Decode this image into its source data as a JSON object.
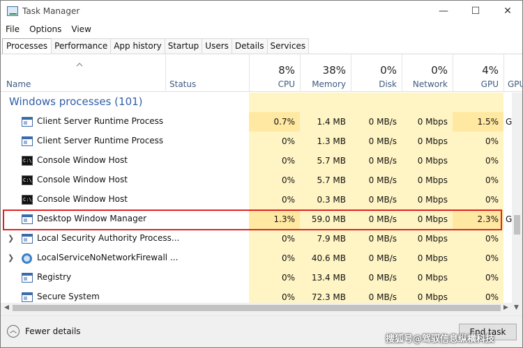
{
  "window": {
    "title": "Task Manager",
    "controls": {
      "minimize": "—",
      "maximize": "☐",
      "close": "✕"
    }
  },
  "menu": [
    "File",
    "Options",
    "View"
  ],
  "tabs": [
    "Processes",
    "Performance",
    "App history",
    "Startup",
    "Users",
    "Details",
    "Services"
  ],
  "active_tab": "Processes",
  "columns": {
    "name": "Name",
    "status": "Status",
    "cpu": {
      "pct": "8%",
      "label": "CPU"
    },
    "memory": {
      "pct": "38%",
      "label": "Memory"
    },
    "disk": {
      "pct": "0%",
      "label": "Disk"
    },
    "network": {
      "pct": "0%",
      "label": "Network"
    },
    "gpu": {
      "pct": "4%",
      "label": "GPU"
    },
    "gpu_engine": "GPU"
  },
  "group": {
    "title": "Windows processes (101)"
  },
  "processes": [
    {
      "name": "Client Server Runtime Process",
      "icon": "window-icon",
      "expandable": false,
      "cpu": "0.7%",
      "memory": "1.4 MB",
      "disk": "0 MB/s",
      "network": "0 Mbps",
      "gpu": "1.5%",
      "gpu_engine": "G"
    },
    {
      "name": "Client Server Runtime Process",
      "icon": "window-icon",
      "expandable": false,
      "cpu": "0%",
      "memory": "1.3 MB",
      "disk": "0 MB/s",
      "network": "0 Mbps",
      "gpu": "0%",
      "gpu_engine": ""
    },
    {
      "name": "Console Window Host",
      "icon": "console-icon",
      "expandable": false,
      "cpu": "0%",
      "memory": "5.7 MB",
      "disk": "0 MB/s",
      "network": "0 Mbps",
      "gpu": "0%",
      "gpu_engine": ""
    },
    {
      "name": "Console Window Host",
      "icon": "console-icon",
      "expandable": false,
      "cpu": "0%",
      "memory": "5.7 MB",
      "disk": "0 MB/s",
      "network": "0 Mbps",
      "gpu": "0%",
      "gpu_engine": ""
    },
    {
      "name": "Console Window Host",
      "icon": "console-icon",
      "expandable": false,
      "cpu": "0%",
      "memory": "0.3 MB",
      "disk": "0 MB/s",
      "network": "0 Mbps",
      "gpu": "0%",
      "gpu_engine": ""
    },
    {
      "name": "Desktop Window Manager",
      "icon": "window-icon",
      "expandable": false,
      "cpu": "1.3%",
      "memory": "59.0 MB",
      "disk": "0 MB/s",
      "network": "0 Mbps",
      "gpu": "2.3%",
      "gpu_engine": "G"
    },
    {
      "name": "Local Security Authority Process...",
      "icon": "window-icon",
      "expandable": true,
      "cpu": "0%",
      "memory": "7.9 MB",
      "disk": "0 MB/s",
      "network": "0 Mbps",
      "gpu": "0%",
      "gpu_engine": ""
    },
    {
      "name": "LocalServiceNoNetworkFirewall ...",
      "icon": "gear-icon",
      "expandable": true,
      "cpu": "0%",
      "memory": "40.6 MB",
      "disk": "0 MB/s",
      "network": "0 Mbps",
      "gpu": "0%",
      "gpu_engine": ""
    },
    {
      "name": "Registry",
      "icon": "window-icon",
      "expandable": false,
      "cpu": "0%",
      "memory": "13.4 MB",
      "disk": "0 MB/s",
      "network": "0 Mbps",
      "gpu": "0%",
      "gpu_engine": ""
    },
    {
      "name": "Secure System",
      "icon": "window-icon",
      "expandable": false,
      "cpu": "0%",
      "memory": "72.3 MB",
      "disk": "0 MB/s",
      "network": "0 Mbps",
      "gpu": "0%",
      "gpu_engine": ""
    }
  ],
  "selected_process": "Desktop Window Manager",
  "footer": {
    "fewer_details": "Fewer details",
    "end_task": "End task",
    "watermark": "搜狐号@驾驭信息纵横科技"
  },
  "colors": {
    "heat_light": "#fff4c4",
    "heat_mid": "#ffe8a1",
    "accent_blue": "#2f5ea8",
    "selection_outline": "#e02020"
  }
}
